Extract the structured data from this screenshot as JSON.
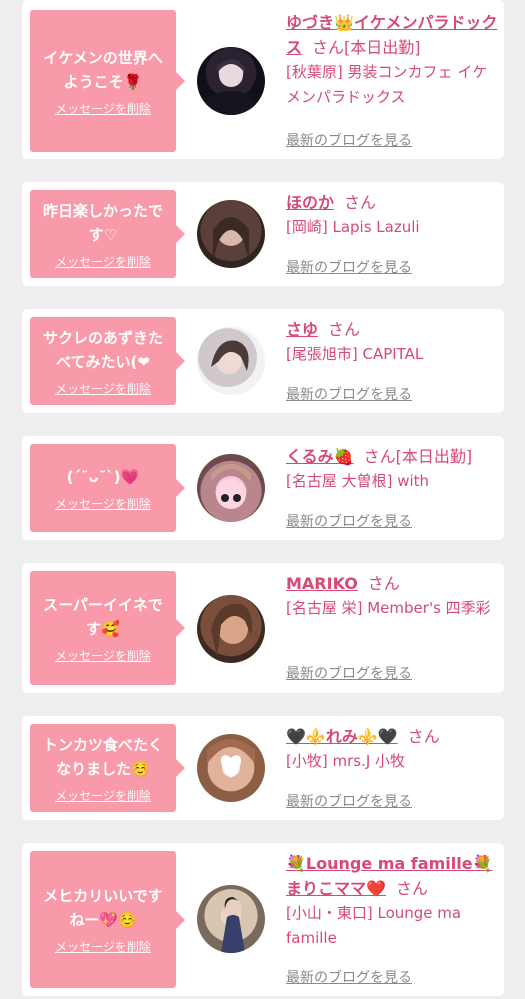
{
  "colors": {
    "accent": "#d64a75",
    "bubble": "#f99aab",
    "card": "#ffffff",
    "bg": "#eeeeee",
    "muted": "#8a8a8a"
  },
  "cards": [
    {
      "msg_lines": [
        "イケメンの世界へ",
        "ようこそ🌹"
      ],
      "delete": "メッセージを削除",
      "name": "ゆづき👑イケメンパラドックス",
      "san": "さん",
      "status": "[本日出勤]",
      "shop": "[秋葉原] 男装コンカフェ イケメンパラドックス",
      "blog": "最新のブログを見る",
      "avatar_icon": "person-avatar-icon"
    },
    {
      "msg_lines": [
        "昨日楽しかったで",
        "す♡"
      ],
      "delete": "メッセージを削除",
      "name": "ほのか",
      "san": "さん",
      "status": "",
      "shop": "[岡崎] Lapis Lazuli",
      "blog": "最新のブログを見る",
      "avatar_icon": "person-avatar-icon"
    },
    {
      "msg_lines": [
        "サクレのあずきた",
        "べてみたい(❤"
      ],
      "delete": "メッセージを削除",
      "name": "さゆ",
      "san": "さん",
      "status": "",
      "shop": "[尾張旭市] CAPITAL",
      "blog": "最新のブログを見る",
      "avatar_icon": "person-avatar-icon"
    },
    {
      "msg_lines": [
        "(ˊ˘ᴗ˘ˋ)💗"
      ],
      "delete": "メッセージを削除",
      "name": "くるみ🍓",
      "san": "さん",
      "status": "[本日出勤]",
      "shop": "[名古屋 大曽根] with",
      "blog": "最新のブログを見る",
      "avatar_icon": "person-avatar-icon"
    },
    {
      "msg_lines": [
        "スーパーイイネで",
        "す🥰"
      ],
      "delete": "メッセージを削除",
      "name": "MARIKO",
      "san": "さん",
      "status": "",
      "shop": "[名古屋 栄] Member's 四季彩",
      "blog": "最新のブログを見る",
      "avatar_icon": "person-avatar-icon"
    },
    {
      "msg_lines": [
        "トンカツ食べたく",
        "なりました☺️"
      ],
      "delete": "メッセージを削除",
      "name": "🖤⚜️れみ⚜️🖤",
      "san": "さん",
      "status": "",
      "shop": "[小牧] mrs.J 小牧",
      "blog": "最新のブログを見る",
      "avatar_icon": "person-avatar-icon"
    },
    {
      "msg_lines": [
        "メヒカリいいです",
        "ねー💖☺️"
      ],
      "delete": "メッセージを削除",
      "name": "💐Lounge ma famille💐まりこママ❤️",
      "san": "さん",
      "status": "",
      "shop": "[小山・東口] Lounge ma famille",
      "blog": "最新のブログを見る",
      "avatar_icon": "person-avatar-icon"
    }
  ]
}
